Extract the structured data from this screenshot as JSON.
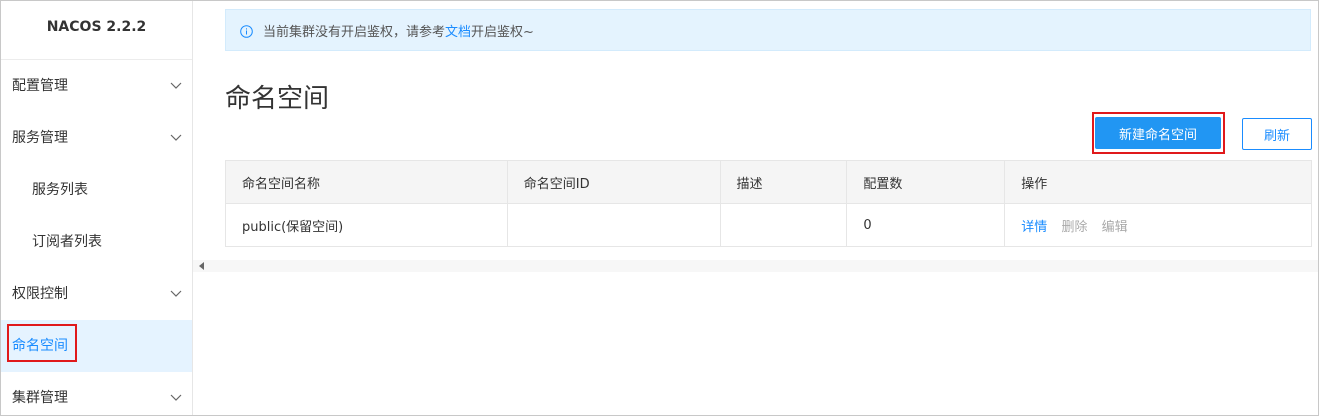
{
  "brand": "NACOS 2.2.2",
  "sidebar": {
    "items": [
      {
        "label": "配置管理",
        "has_chevron": true
      },
      {
        "label": "服务管理",
        "has_chevron": true
      },
      {
        "label": "服务列表",
        "has_chevron": false
      },
      {
        "label": "订阅者列表",
        "has_chevron": false
      },
      {
        "label": "权限控制",
        "has_chevron": true
      },
      {
        "label": "命名空间",
        "has_chevron": false,
        "active": true
      },
      {
        "label": "集群管理",
        "has_chevron": true
      }
    ]
  },
  "notice": {
    "icon": "info-circle-icon",
    "text_before": "当前集群没有开启鉴权，请参考",
    "link": "文档",
    "text_after": "开启鉴权~"
  },
  "page": {
    "title": "命名空间"
  },
  "toolbar": {
    "create_label": "新建命名空间",
    "refresh_label": "刷新"
  },
  "table": {
    "columns": [
      "命名空间名称",
      "命名空间ID",
      "描述",
      "配置数",
      "操作"
    ],
    "rows": [
      {
        "name": "public(保留空间)",
        "id": "",
        "description": "",
        "config_count": "0",
        "actions": {
          "detail": "详情",
          "delete": "删除",
          "edit": "编辑"
        }
      }
    ]
  },
  "colors": {
    "primary": "#2196f3",
    "link": "#1a8cff",
    "highlight_border": "#e0191b",
    "active_bg": "#e5f3ff",
    "notice_bg": "#e4f3fe"
  }
}
